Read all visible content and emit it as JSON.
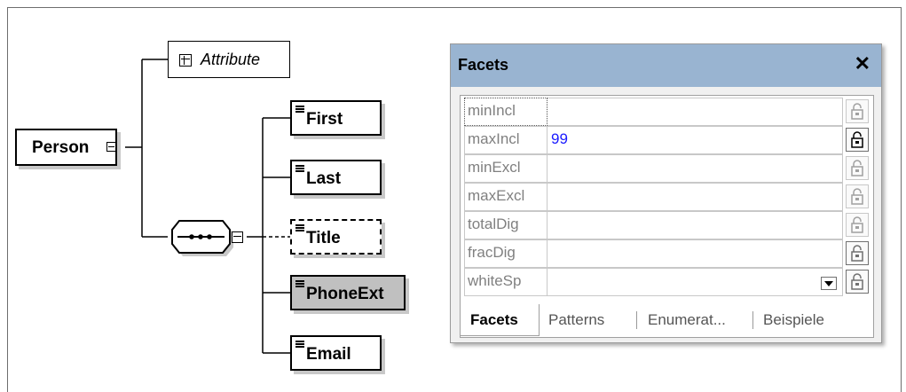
{
  "diagram": {
    "root": {
      "label": "Person"
    },
    "attribute": {
      "label": "Attribute"
    },
    "children": [
      {
        "label": "First"
      },
      {
        "label": "Last"
      },
      {
        "label": "Title"
      },
      {
        "label": "PhoneExt"
      },
      {
        "label": "Email"
      }
    ]
  },
  "facets_panel": {
    "title": "Facets",
    "close_glyph": "✕",
    "rows": [
      {
        "name": "minIncl",
        "value": ""
      },
      {
        "name": "maxIncl",
        "value": "99"
      },
      {
        "name": "minExcl",
        "value": ""
      },
      {
        "name": "maxExcl",
        "value": ""
      },
      {
        "name": "totalDig",
        "value": ""
      },
      {
        "name": "fracDig",
        "value": ""
      },
      {
        "name": "whiteSp",
        "value": ""
      }
    ],
    "tabs": [
      "Facets",
      "Patterns",
      "Enumerat...",
      "Beispiele"
    ]
  },
  "icons": {
    "lock": "padlock-icon",
    "expand": "expand-plus-icon",
    "collapse": "collapse-minus-icon",
    "sequence": "sequence-compositor-icon"
  },
  "colors": {
    "panel_header": "#99b4d1",
    "value_text": "#1a1aff",
    "label_gray": "#808080"
  }
}
